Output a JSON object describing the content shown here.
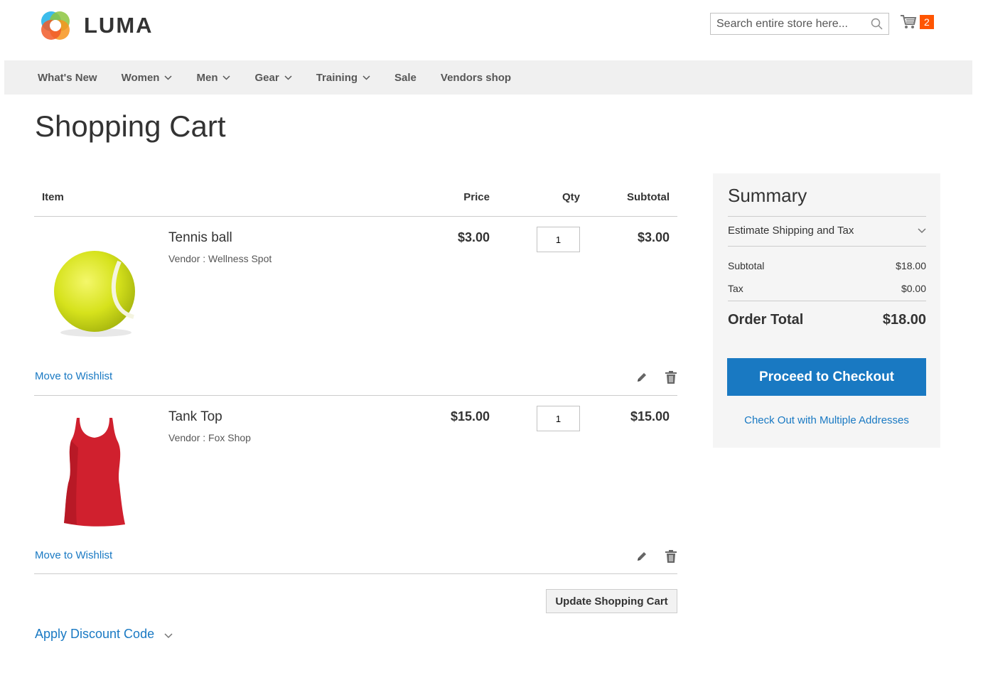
{
  "header": {
    "logo_text": "LUMA",
    "search_placeholder": "Search entire store here...",
    "cart_count": "2"
  },
  "nav": {
    "items": [
      {
        "label": "What's New",
        "has_menu": false
      },
      {
        "label": "Women",
        "has_menu": true
      },
      {
        "label": "Men",
        "has_menu": true
      },
      {
        "label": "Gear",
        "has_menu": true
      },
      {
        "label": "Training",
        "has_menu": true
      },
      {
        "label": "Sale",
        "has_menu": false
      },
      {
        "label": "Vendors shop",
        "has_menu": false
      }
    ]
  },
  "page": {
    "title": "Shopping Cart"
  },
  "cart": {
    "columns": {
      "item": "Item",
      "price": "Price",
      "qty": "Qty",
      "subtotal": "Subtotal"
    },
    "items": [
      {
        "name": "Tennis ball",
        "vendor": "Vendor : Wellness Spot",
        "price": "$3.00",
        "qty": "1",
        "subtotal": "$3.00",
        "wishlist": "Move to Wishlist"
      },
      {
        "name": "Tank Top",
        "vendor": "Vendor : Fox Shop",
        "price": "$15.00",
        "qty": "1",
        "subtotal": "$15.00",
        "wishlist": "Move to Wishlist"
      }
    ],
    "update_button": "Update Shopping Cart",
    "discount_label": "Apply Discount Code"
  },
  "summary": {
    "title": "Summary",
    "estimate": "Estimate Shipping and Tax",
    "subtotal_label": "Subtotal",
    "subtotal_value": "$18.00",
    "tax_label": "Tax",
    "tax_value": "$0.00",
    "order_total_label": "Order Total",
    "order_total_value": "$18.00",
    "checkout_button": "Proceed to Checkout",
    "multi_address_link": "Check Out with Multiple Addresses"
  },
  "colors": {
    "link": "#1979c3",
    "primary_button": "#1979c2",
    "cart_badge": "#ff5501",
    "nav_bg": "#f0f0f0",
    "summary_bg": "#f5f5f5"
  },
  "icons": [
    "luma-logo-icon",
    "search-icon",
    "cart-icon",
    "chevron-down-icon",
    "pencil-icon",
    "trash-icon"
  ]
}
